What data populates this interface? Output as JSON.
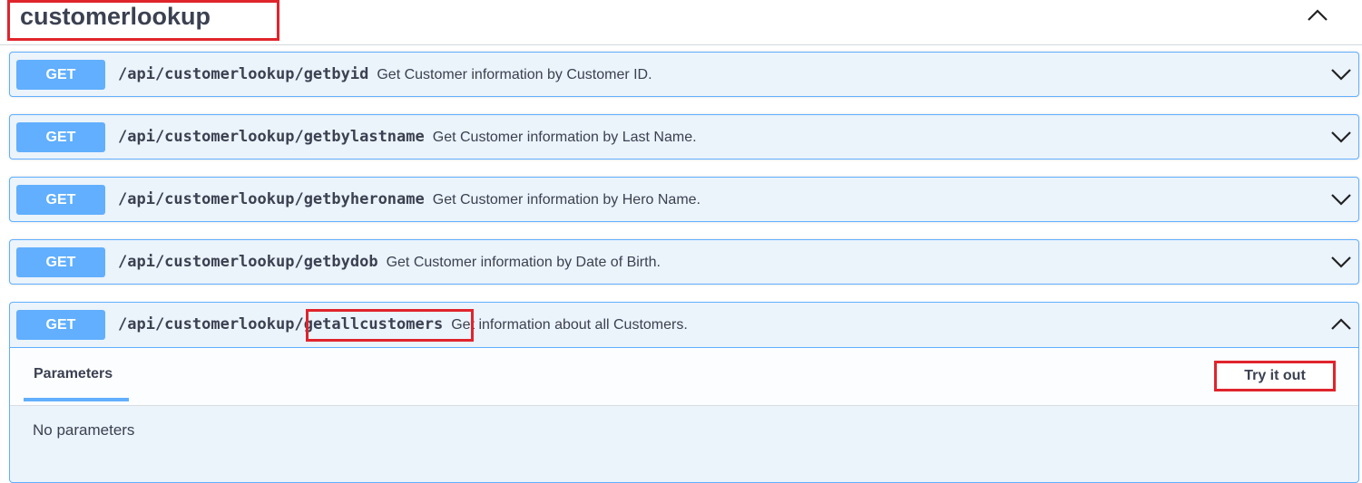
{
  "tag": {
    "title": "customerlookup"
  },
  "operations": [
    {
      "method": "GET",
      "path": "/api/customerlookup/getbyid",
      "summary": "Get Customer information by Customer ID."
    },
    {
      "method": "GET",
      "path": "/api/customerlookup/getbylastname",
      "summary": "Get Customer information by Last Name."
    },
    {
      "method": "GET",
      "path": "/api/customerlookup/getbyheroname",
      "summary": "Get Customer information by Hero Name."
    },
    {
      "method": "GET",
      "path": "/api/customerlookup/getbydob",
      "summary": "Get Customer information by Date of Birth."
    }
  ],
  "expanded": {
    "method": "GET",
    "path_prefix": "/api/customerlookup",
    "path_segment": "/getallcustomers",
    "summary": "Get information about all Customers.",
    "params_tab": "Parameters",
    "try_label": "Try it out",
    "no_params": "No parameters"
  },
  "colors": {
    "get_accent": "#61affe",
    "highlight": "#e0242c",
    "text": "#3b4151"
  },
  "icons": {
    "tag_toggle": "chevron-up-icon",
    "op_toggle": "chevron-down-icon",
    "expanded_toggle": "chevron-up-icon"
  }
}
